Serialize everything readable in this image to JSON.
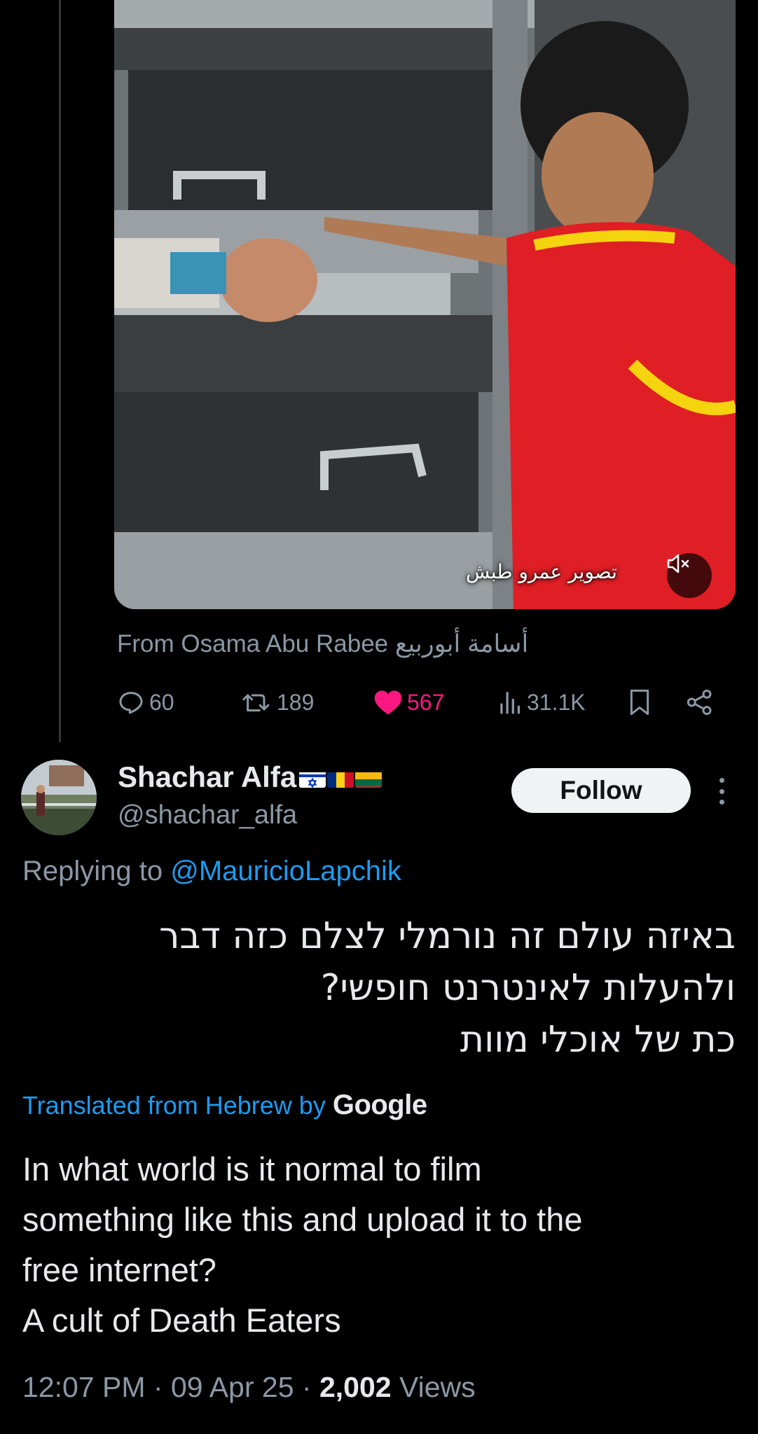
{
  "media": {
    "caption_text": "تصوير عمرو طبش",
    "mute_icon": "speaker-muted-icon"
  },
  "source": {
    "text": "From Osama Abu Rabee أسامة أبوربيع"
  },
  "actions": {
    "replies": "60",
    "reposts": "189",
    "likes": "567",
    "views": "31.1K",
    "like_color": "#f91880",
    "icons": [
      "reply-icon",
      "repost-icon",
      "heart-icon",
      "views-icon",
      "bookmark-icon",
      "share-icon"
    ]
  },
  "reply": {
    "display_name": "Shachar Alfa",
    "flags": [
      "israel-flag",
      "romania-flag",
      "lithuania-flag"
    ],
    "handle": "@shachar_alfa",
    "follow_label": "Follow",
    "replying_to_prefix": "Replying to",
    "replying_to_mention": "@MauricioLapchik",
    "hebrew_lines": [
      "באיזה עולם זה נורמלי לצלם כזה דבר",
      "ולהעלות לאינטרנט חופשי?",
      "כת של אוכלי מוות"
    ],
    "translated_prefix": "Translated from Hebrew by",
    "translated_by": "Google",
    "translation_lines": [
      "In what world is it normal to film",
      "something like this and upload it to the",
      "free internet?",
      "A cult of Death Eaters"
    ],
    "time": "12:07 PM",
    "date": "09 Apr 25",
    "views_count": "2,002",
    "views_label": "Views",
    "separator": "·"
  },
  "colors": {
    "background": "#000000",
    "primary_text": "#e7e9ea",
    "secondary_text": "#8b98a5",
    "link": "#1d9bf0",
    "like": "#f91880"
  }
}
